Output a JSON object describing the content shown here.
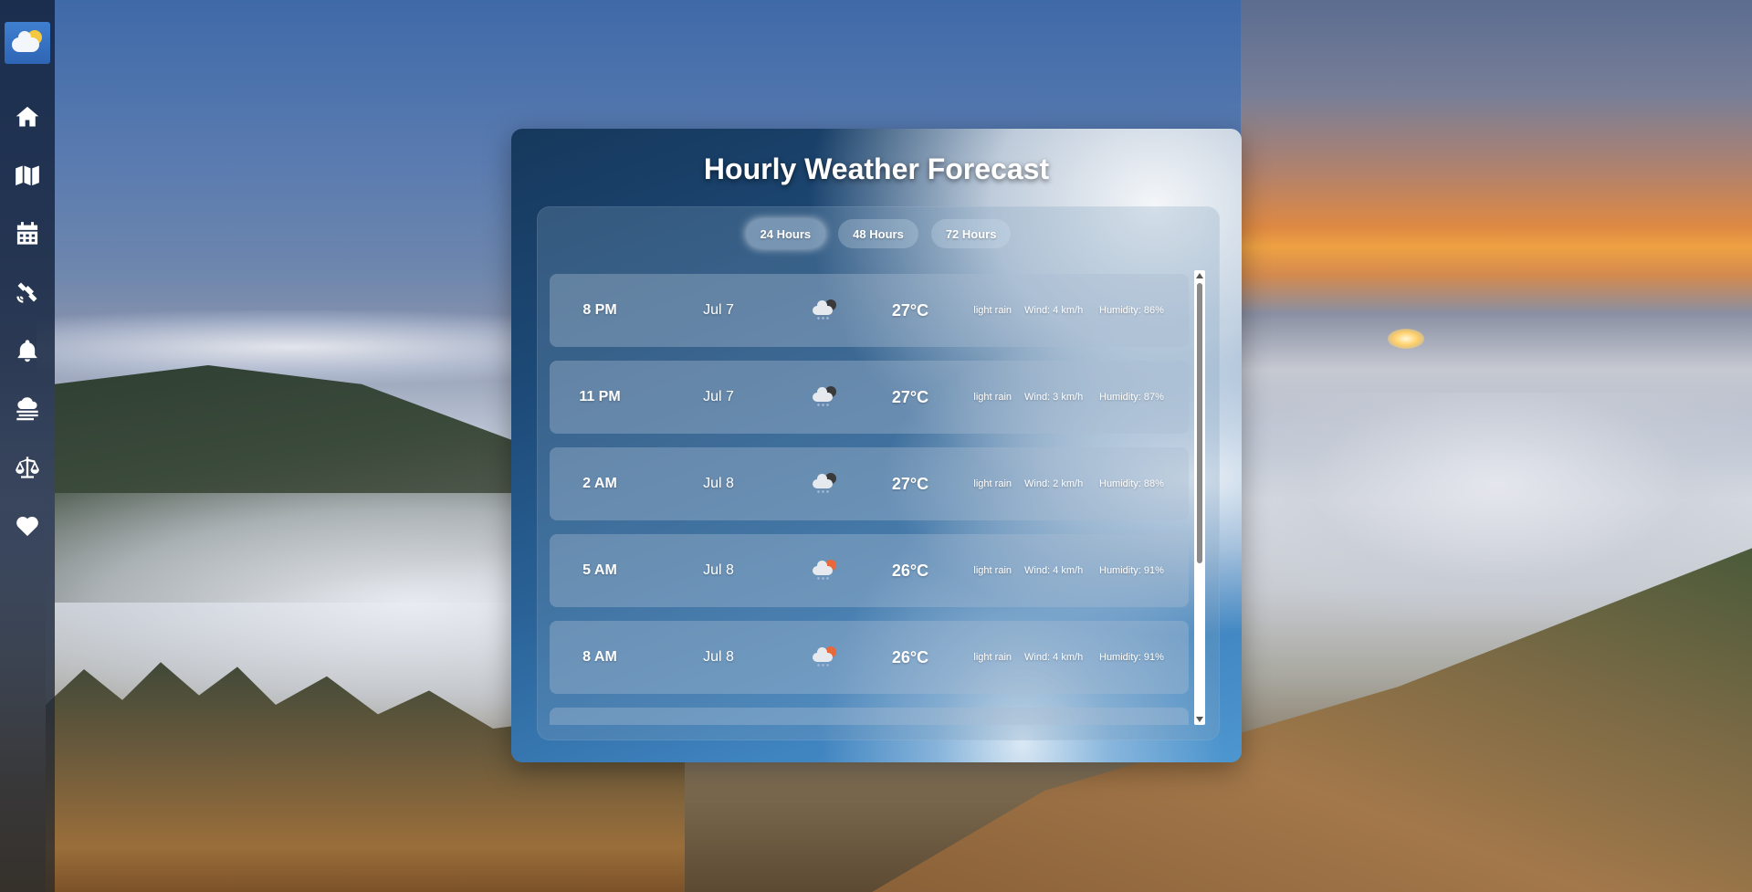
{
  "app": {
    "title": "Hourly Weather Forecast"
  },
  "sidebar": {
    "items": [
      {
        "icon": "home-icon"
      },
      {
        "icon": "map-icon"
      },
      {
        "icon": "calendar-icon"
      },
      {
        "icon": "satellite-icon"
      },
      {
        "icon": "bell-icon"
      },
      {
        "icon": "fog-icon"
      },
      {
        "icon": "scale-icon"
      },
      {
        "icon": "heart-icon"
      }
    ]
  },
  "tabs": [
    {
      "label": "24 Hours",
      "active": true
    },
    {
      "label": "48 Hours",
      "active": false
    },
    {
      "label": "72 Hours",
      "active": false
    }
  ],
  "forecast": [
    {
      "time": "8 PM",
      "date": "Jul 7",
      "icon": "night-rain-icon",
      "temp": "27°C",
      "desc": "light rain",
      "wind": "Wind: 4 km/h",
      "humidity": "Humidity: 86%"
    },
    {
      "time": "11 PM",
      "date": "Jul 7",
      "icon": "night-rain-icon",
      "temp": "27°C",
      "desc": "light rain",
      "wind": "Wind: 3 km/h",
      "humidity": "Humidity: 87%"
    },
    {
      "time": "2 AM",
      "date": "Jul 8",
      "icon": "night-rain-icon",
      "temp": "27°C",
      "desc": "light rain",
      "wind": "Wind: 2 km/h",
      "humidity": "Humidity: 88%"
    },
    {
      "time": "5 AM",
      "date": "Jul 8",
      "icon": "day-rain-icon",
      "temp": "26°C",
      "desc": "light rain",
      "wind": "Wind: 4 km/h",
      "humidity": "Humidity: 91%"
    },
    {
      "time": "8 AM",
      "date": "Jul 8",
      "icon": "day-rain-icon",
      "temp": "26°C",
      "desc": "light rain",
      "wind": "Wind: 4 km/h",
      "humidity": "Humidity: 91%"
    }
  ],
  "colors": {
    "sidebar_icon": "#ffffff",
    "logo_bg": "#3f7fd0",
    "sun": "#f5c842"
  }
}
